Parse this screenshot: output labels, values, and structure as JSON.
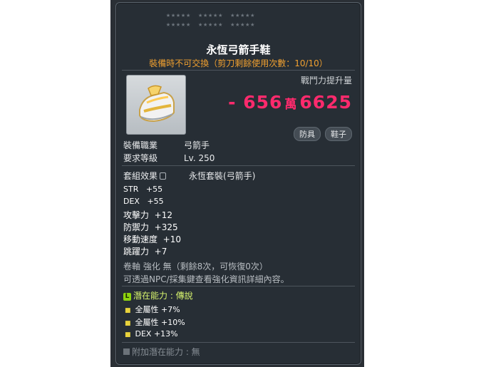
{
  "item": {
    "name": "永恆弓箭手鞋",
    "trade_note": "裝備時不可交換（剪刀剩餘使用次數：10/10）",
    "cp_label": "戰鬥力提升量",
    "cp_prefix": "-",
    "cp_big": "656",
    "cp_unit": "萬",
    "cp_rest": "6625",
    "tags": [
      "防具",
      "鞋子"
    ]
  },
  "requirements": {
    "job_label": "裝備職業",
    "job_value": "弓箭手",
    "level_label": "要求等級",
    "level_value": "Lv. 250"
  },
  "set_effect": {
    "label": "套組效果",
    "value": "永恆套裝(弓箭手)"
  },
  "stats": [
    {
      "name": "STR",
      "value": "+55"
    },
    {
      "name": "DEX",
      "value": "+55"
    },
    {
      "name": "攻擊力",
      "value": "+12"
    },
    {
      "name": "防禦力",
      "value": "+325"
    },
    {
      "name": "移動速度",
      "value": "+10"
    },
    {
      "name": "跳躍力",
      "value": "+7"
    }
  ],
  "notes": {
    "scroll": "卷軸 強化 無（剩餘8次，可恢復0次）",
    "npc": "可透過NPC/採集鍵查看強化資訊詳細內容。"
  },
  "potential": {
    "badge": "L",
    "label": "潛在能力 : 傳說",
    "lines": [
      "全屬性 +7%",
      "全屬性 +10%",
      "DEX +13%"
    ]
  },
  "additional_potential": {
    "label": "附加潛在能力 : 無"
  },
  "colors": {
    "accent_pink": "#ff2a6d",
    "orange": "#f0a030",
    "potential_green": "#d8f56e"
  }
}
